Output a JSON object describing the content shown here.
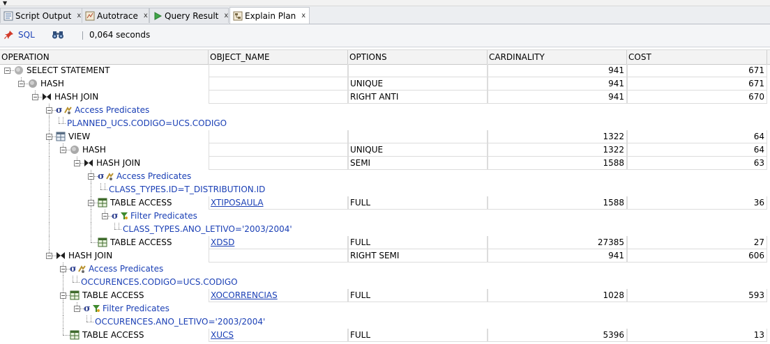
{
  "tabs": [
    {
      "label": "Script Output",
      "close": "x"
    },
    {
      "label": "Autotrace",
      "close": "x"
    },
    {
      "label": "Query Result",
      "close": "x"
    },
    {
      "label": "Explain Plan",
      "close": "x"
    }
  ],
  "toolbar": {
    "sql_label": "SQL",
    "elapsed": "0,064 seconds"
  },
  "columns": [
    "OPERATION",
    "OBJECT_NAME",
    "OPTIONS",
    "CARDINALITY",
    "COST"
  ],
  "rows": [
    {
      "op": "SELECT STATEMENT",
      "object": "",
      "options": "",
      "card": "941",
      "cost": "671"
    },
    {
      "op": "HASH",
      "object": "",
      "options": "UNIQUE",
      "card": "941",
      "cost": "671"
    },
    {
      "op": "HASH JOIN",
      "object": "",
      "options": "RIGHT ANTI",
      "card": "941",
      "cost": "670"
    },
    {
      "op": "Access Predicates",
      "object": "",
      "options": "",
      "card": "",
      "cost": ""
    },
    {
      "op": "PLANNED_UCS.CODIGO=UCS.CODIGO",
      "object": "",
      "options": "",
      "card": "",
      "cost": ""
    },
    {
      "op": "VIEW",
      "object": "",
      "options": "",
      "card": "1322",
      "cost": "64"
    },
    {
      "op": "HASH",
      "object": "",
      "options": "UNIQUE",
      "card": "1322",
      "cost": "64"
    },
    {
      "op": "HASH JOIN",
      "object": "",
      "options": "SEMI",
      "card": "1588",
      "cost": "63"
    },
    {
      "op": "Access Predicates",
      "object": "",
      "options": "",
      "card": "",
      "cost": ""
    },
    {
      "op": "CLASS_TYPES.ID=T_DISTRIBUTION.ID",
      "object": "",
      "options": "",
      "card": "",
      "cost": ""
    },
    {
      "op": "TABLE ACCESS",
      "object": "XTIPOSAULA",
      "options": "FULL",
      "card": "1588",
      "cost": "36"
    },
    {
      "op": "Filter Predicates",
      "object": "",
      "options": "",
      "card": "",
      "cost": ""
    },
    {
      "op": "CLASS_TYPES.ANO_LETIVO='2003/2004'",
      "object": "",
      "options": "",
      "card": "",
      "cost": ""
    },
    {
      "op": "TABLE ACCESS",
      "object": "XDSD",
      "options": "FULL",
      "card": "27385",
      "cost": "27"
    },
    {
      "op": "HASH JOIN",
      "object": "",
      "options": "RIGHT SEMI",
      "card": "941",
      "cost": "606"
    },
    {
      "op": "Access Predicates",
      "object": "",
      "options": "",
      "card": "",
      "cost": ""
    },
    {
      "op": "OCCURENCES.CODIGO=UCS.CODIGO",
      "object": "",
      "options": "",
      "card": "",
      "cost": ""
    },
    {
      "op": "TABLE ACCESS",
      "object": "XOCORRENCIAS",
      "options": "FULL",
      "card": "1028",
      "cost": "593"
    },
    {
      "op": "Filter Predicates",
      "object": "",
      "options": "",
      "card": "",
      "cost": ""
    },
    {
      "op": "OCCURENCES.ANO_LETIVO='2003/2004'",
      "object": "",
      "options": "",
      "card": "",
      "cost": ""
    },
    {
      "op": "TABLE ACCESS",
      "object": "XUCS",
      "options": "FULL",
      "card": "5396",
      "cost": "13"
    }
  ]
}
